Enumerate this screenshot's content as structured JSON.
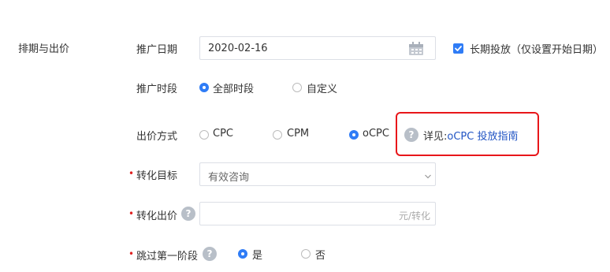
{
  "section": {
    "title": "排期与出价"
  },
  "promo_date": {
    "label": "推广日期",
    "value": "2020-02-16",
    "icon": "calendar-icon",
    "long_term": {
      "checked": true,
      "label": "长期投放（仅设置开始日期）"
    }
  },
  "promo_period": {
    "label": "推广时段",
    "options": [
      {
        "label": "全部时段",
        "selected": true
      },
      {
        "label": "自定义",
        "selected": false
      }
    ]
  },
  "bid_method": {
    "label": "出价方式",
    "options": [
      {
        "label": "CPC",
        "selected": false
      },
      {
        "label": "CPM",
        "selected": false
      },
      {
        "label": "oCPC",
        "selected": true
      }
    ],
    "help_icon": "question-icon",
    "guide_prefix": "详见:",
    "guide_link": "oCPC 投放指南"
  },
  "conversion_goal": {
    "required_mark": "•",
    "label": "转化目标",
    "value": "有效咨询",
    "icon": "chevron-down-icon"
  },
  "conversion_bid": {
    "required_mark": "•",
    "label": "转化出价",
    "help_icon": "question-icon",
    "value": "",
    "suffix": "元/转化"
  },
  "skip_stage_one": {
    "required_mark": "•",
    "label": "跳过第一阶段",
    "help_icon": "question-icon",
    "options": [
      {
        "label": "是",
        "selected": true
      },
      {
        "label": "否",
        "selected": false
      }
    ]
  },
  "colors": {
    "accent": "#2f7cf6",
    "highlight": "#e8161a",
    "link": "#2255c4",
    "required": "#e02020"
  }
}
